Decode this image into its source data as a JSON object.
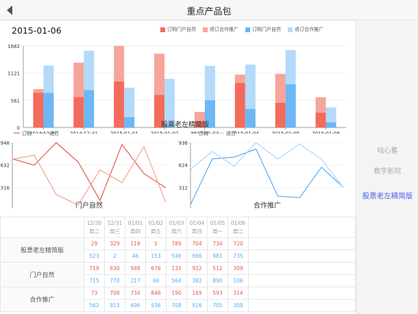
{
  "header": {
    "title": "重点产品包",
    "back_icon": "back-arrow-icon"
  },
  "date": "2015-01-06",
  "legend": [
    {
      "label": "订购门户自然",
      "color": "#f26b5b"
    },
    {
      "label": "退订合作推广",
      "color": "#f6a59b"
    },
    {
      "label": "订购门户自然",
      "color": "#6cb7f4"
    },
    {
      "label": "退订合作推广",
      "color": "#b3dafb"
    }
  ],
  "sidebar": {
    "items": [
      {
        "label": "咕心蓄",
        "active": false
      },
      {
        "label": "数字影院",
        "active": false
      },
      {
        "label": "股票老左精简版",
        "active": true
      }
    ]
  },
  "captions": {
    "bar": "股票老左精简版",
    "left": "门户自然",
    "right": "合作推广"
  },
  "line_legend_left": [
    {
      "label": "订购",
      "color": "#e8574a"
    },
    {
      "label": "退订",
      "color": "#f4a090"
    }
  ],
  "line_legend_right": [
    {
      "label": "订购",
      "color": "#5aa9ef"
    },
    {
      "label": "退订",
      "color": "#a9d5fb"
    }
  ],
  "chart_data": [
    {
      "type": "bar",
      "title": "股票老左精简版",
      "categories": [
        "2014-12-30",
        "2014-12-31",
        "2015-01-01",
        "2015-01-02",
        "2015-01-03",
        "2015-01-04",
        "2015-01-05",
        "2015-01-06"
      ],
      "ylim": [
        0,
        1682
      ],
      "yticks": [
        "0",
        "561",
        "1121",
        "1682"
      ],
      "series": [
        {
          "name": "订购门户自然",
          "stack": "a",
          "values": [
            719,
            630,
            948,
            676,
            131,
            922,
            512,
            309
          ]
        },
        {
          "name": "退订合作推广",
          "stack": "a",
          "values": [
            73,
            708,
            734,
            846,
            190,
            169,
            593,
            314
          ]
        },
        {
          "name": "订购门户自然",
          "stack": "b",
          "values": [
            715,
            770,
            217,
            66,
            564,
            382,
            890,
            106
          ]
        },
        {
          "name": "退订合作推广",
          "stack": "b",
          "values": [
            562,
            813,
            606,
            936,
            708,
            916,
            705,
            308
          ]
        }
      ]
    },
    {
      "type": "line",
      "title": "门户自然",
      "categories": [
        "12-30",
        "12-31",
        "01-01",
        "01-02",
        "01-03",
        "01-04",
        "01-05",
        "01-06"
      ],
      "ylim": [
        0,
        948
      ],
      "yticks": [
        "0",
        "316",
        "632",
        "948"
      ],
      "series": [
        {
          "name": "订购",
          "values": [
            719,
            630,
            948,
            676,
            131,
            922,
            512,
            309
          ]
        },
        {
          "name": "退订",
          "values": [
            715,
            770,
            217,
            66,
            564,
            382,
            890,
            106
          ]
        }
      ]
    },
    {
      "type": "line",
      "title": "合作推广",
      "categories": [
        "12-30",
        "12-31",
        "01-01",
        "01-02",
        "01-03",
        "01-04",
        "01-05",
        "01-06"
      ],
      "ylim": [
        0,
        936
      ],
      "yticks": [
        "0",
        "312",
        "624",
        "936"
      ],
      "series": [
        {
          "name": "订购",
          "values": [
            73,
            708,
            734,
            846,
            190,
            169,
            593,
            314
          ]
        },
        {
          "name": "退订",
          "values": [
            562,
            813,
            606,
            936,
            708,
            916,
            705,
            308
          ]
        }
      ]
    }
  ],
  "table": {
    "columns": [
      {
        "date": "12/30",
        "day": "周二"
      },
      {
        "date": "12/31",
        "day": "周三"
      },
      {
        "date": "01/01",
        "day": "周四"
      },
      {
        "date": "01/02",
        "day": "周五"
      },
      {
        "date": "01/03",
        "day": "周六"
      },
      {
        "date": "01/04",
        "day": "周日"
      },
      {
        "date": "01/05",
        "day": "周一"
      },
      {
        "date": "01/06",
        "day": "周二"
      }
    ],
    "rows": [
      {
        "label": "股票老左精简版",
        "red": [
          "29",
          "329",
          "119",
          "5",
          "789",
          "704",
          "734",
          "720"
        ],
        "blue": [
          "523",
          "2",
          "46",
          "153",
          "546",
          "966",
          "981",
          "735"
        ]
      },
      {
        "label": "门户自然",
        "red": [
          "719",
          "630",
          "948",
          "676",
          "131",
          "922",
          "512",
          "309"
        ],
        "blue": [
          "715",
          "770",
          "217",
          "66",
          "564",
          "382",
          "890",
          "106"
        ]
      },
      {
        "label": "合作推广",
        "red": [
          "73",
          "708",
          "734",
          "846",
          "190",
          "169",
          "593",
          "314"
        ],
        "blue": [
          "562",
          "813",
          "606",
          "936",
          "708",
          "916",
          "705",
          "308"
        ]
      }
    ]
  }
}
